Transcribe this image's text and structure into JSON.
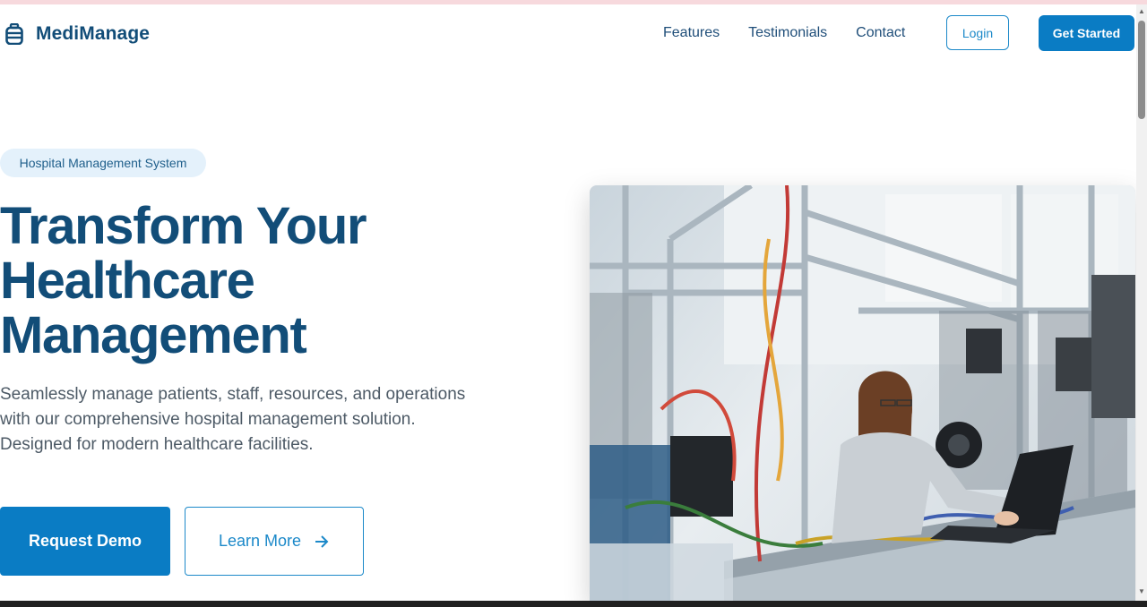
{
  "brand": {
    "name": "MediManage",
    "icon": "hospital-bag-icon",
    "color": "#124d78"
  },
  "nav": {
    "links": [
      "Features",
      "Testimonials",
      "Contact"
    ],
    "login_label": "Login",
    "get_started_label": "Get Started"
  },
  "hero": {
    "badge": "Hospital Management System",
    "headline": [
      "Transform Your",
      "Healthcare",
      "Management"
    ],
    "description": [
      "Seamlessly manage patients, staff, resources, and operations",
      "with our comprehensive hospital management solution.",
      "Designed for modern healthcare facilities."
    ],
    "primary_cta": "Request Demo",
    "secondary_cta": "Learn More",
    "secondary_icon": "arrow-right-icon",
    "image_subject": "photo-engineer-at-laptop"
  },
  "colors": {
    "accent": "#0a7cc4",
    "heading": "#124d78",
    "badge_bg": "#e4f1fb",
    "body_text": "#4d5a66"
  }
}
